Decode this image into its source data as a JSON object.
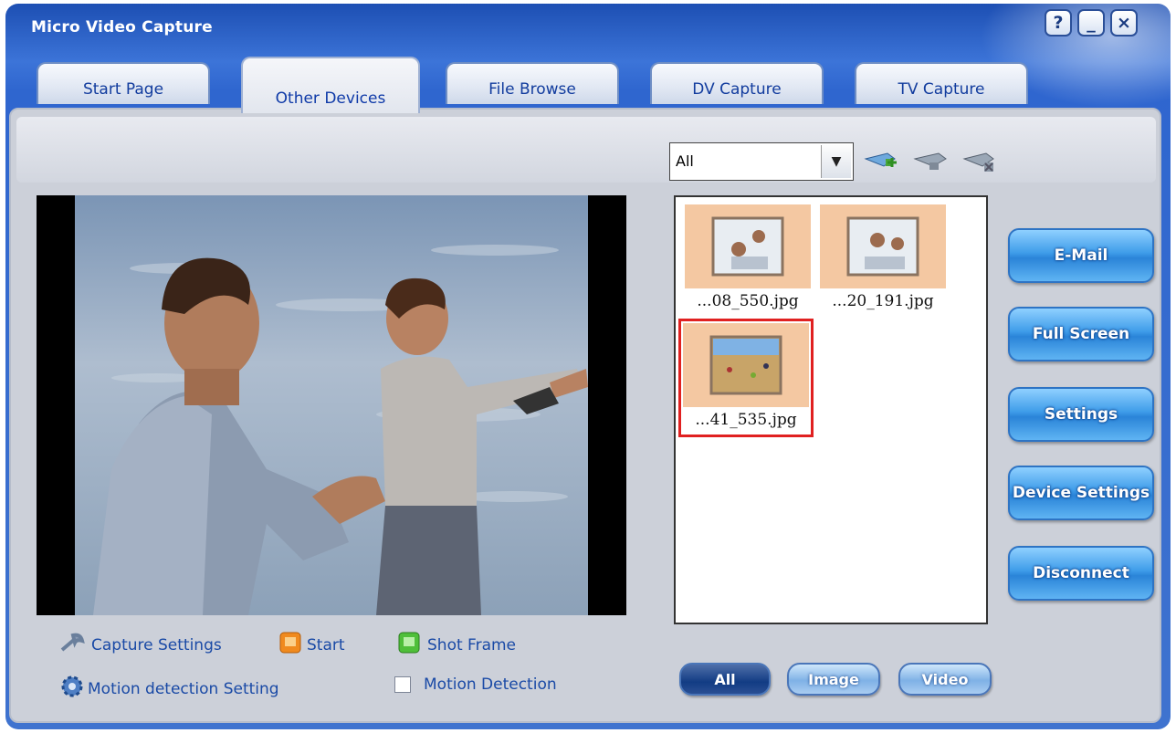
{
  "window": {
    "title": "Micro Video Capture"
  },
  "title_buttons": [
    {
      "name": "help-button",
      "label": "?"
    },
    {
      "name": "minimize-button",
      "label": "_"
    },
    {
      "name": "close-button",
      "label": "×"
    }
  ],
  "tabs": [
    {
      "label": "Start Page"
    },
    {
      "label": "Other Devices"
    },
    {
      "label": "File Browse"
    },
    {
      "label": "DV Capture"
    },
    {
      "label": "TV Capture"
    }
  ],
  "filter": {
    "selected": "All"
  },
  "files": [
    {
      "name": "...08_550.jpg"
    },
    {
      "name": "...20_191.jpg"
    },
    {
      "name": "...41_535.jpg"
    }
  ],
  "side_buttons": [
    "E-Mail",
    "Full Screen",
    "Settings",
    "Device Settings",
    "Disconnect"
  ],
  "controls": {
    "capture_settings": "Capture Settings",
    "start": "Start",
    "shot_frame": "Shot Frame",
    "motion_setting": "Motion detection Setting",
    "motion_detection": "Motion Detection"
  },
  "view_filters": [
    "All",
    "Image",
    "Video"
  ],
  "colors": {
    "accent": "#2f66cf",
    "panel": "#ccd0d9",
    "selection": "#e02020"
  }
}
